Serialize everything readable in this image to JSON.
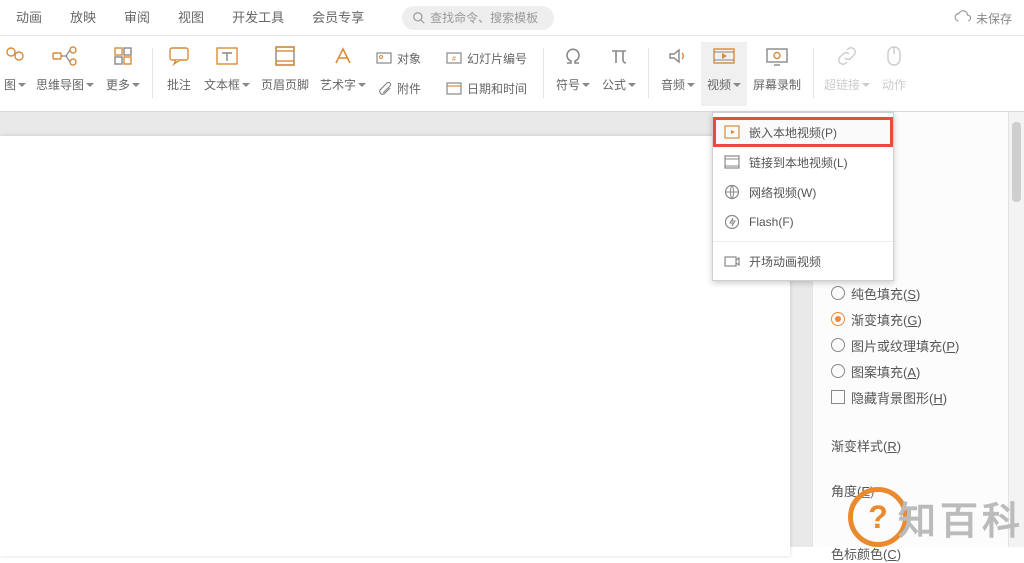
{
  "tabs": {
    "animation": "动画",
    "show": "放映",
    "review": "审阅",
    "view": "视图",
    "devtools": "开发工具",
    "member": "会员专享"
  },
  "search": {
    "placeholder": "查找命令、搜索模板"
  },
  "save_status": "未保存",
  "ribbon": {
    "chart": "图",
    "mindmap": "思维导图",
    "more": "更多",
    "comment": "批注",
    "textbox": "文本框",
    "header_footer": "页眉页脚",
    "wordart": "艺术字",
    "object": "对象",
    "slide_number": "幻灯片编号",
    "attachment": "附件",
    "datetime": "日期和时间",
    "symbol": "符号",
    "equation": "公式",
    "audio": "音频",
    "video": "视频",
    "screen_record": "屏幕录制",
    "hyperlink": "超链接",
    "action": "动作"
  },
  "video_menu": {
    "embed_local": "嵌入本地视频(P)",
    "link_local": "链接到本地视频(L)",
    "web_video": "网络视频(W)",
    "flash": "Flash(F)",
    "opening_anim": "开场动画视频"
  },
  "panel": {
    "solid_fill": "纯色填充",
    "solid_fill_hot": "S",
    "gradient_fill": "渐变填充",
    "gradient_fill_hot": "G",
    "picture_fill": "图片或纹理填充",
    "picture_fill_hot": "P",
    "pattern_fill": "图案填充",
    "pattern_fill_hot": "A",
    "hide_bg": "隐藏背景图形",
    "hide_bg_hot": "H",
    "grad_style": "渐变样式",
    "grad_style_hot": "R",
    "angle": "角度",
    "angle_hot": "E",
    "stop_color": "色标颜色",
    "stop_color_hot": "C"
  },
  "watermark": "知百科"
}
